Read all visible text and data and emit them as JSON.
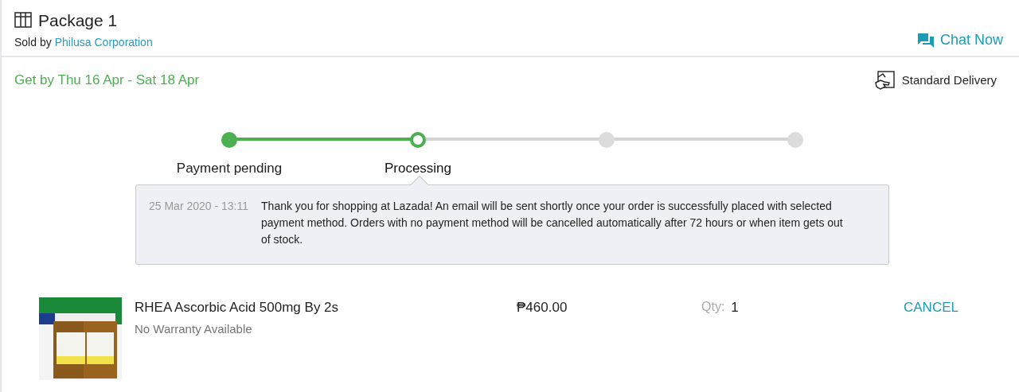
{
  "package": {
    "title": "Package 1",
    "sold_by_label": "Sold by",
    "seller": "Philusa Corporation",
    "chat": "Chat Now"
  },
  "delivery": {
    "estimate": "Get by Thu 16 Apr - Sat 18 Apr",
    "method": "Standard Delivery"
  },
  "steps": [
    {
      "label": "Payment pending",
      "done": true,
      "selected": false
    },
    {
      "label": "Processing",
      "done": true,
      "selected": true
    },
    {
      "done": false,
      "selected": false
    },
    {
      "done": false,
      "selected": false
    }
  ],
  "message": {
    "time": "25 Mar 2020 - 13:11",
    "text": "Thank you for shopping at Lazada! An email will be sent shortly once your order is successfully placed with selected payment method. Orders with no payment method will be cancelled automatically after 72 hours or when item gets out of stock."
  },
  "item": {
    "kind": "picture",
    "name": "RHEA Ascorbic Acid 500mg By 2s",
    "warranty": "No Warranty Available",
    "price": "₱460.00",
    "qty_label": "Qty:",
    "qty": "1",
    "action": "CANCEL"
  }
}
